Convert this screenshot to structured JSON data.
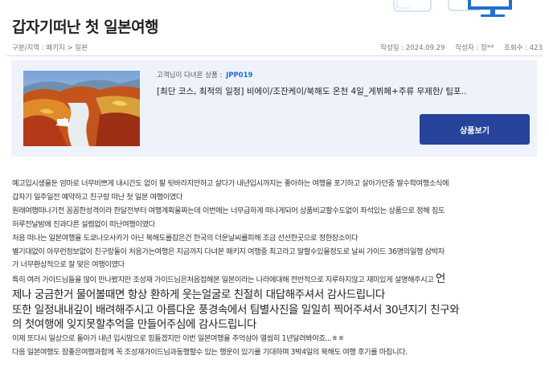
{
  "page": {
    "title": "갑자기떠난 첫 일본여행",
    "breadcrumb": "구분/지역 : 패키지 > 일본",
    "date": "작성일 : 2024.09.29",
    "author": "작성자 : 정**",
    "views": "조회수 : 423"
  },
  "product": {
    "code_label": "고객님이 다녀온 상품 :",
    "code": "JPP019",
    "name": "[최단 코스, 최적의 일정] 비에이/조잔케이/북해도 온천 4일_게뷔페+주류 무제한/ 팁포..",
    "button_label": "상품보기",
    "thumbnail_icon": "autumn-gorge-photo"
  },
  "review": {
    "lines": [
      "예고입시생을둔 엄마로 너무비쁘게 내시간도 없이 팔 뒷바라지만하고 살다가 내년입시까지는 좋아하는 여행을 포기하고 살아가던중 딸수학여행소식에",
      "갑자기 일주일전 예약하고 친구랑 떠난 첫 일본 여행이였다",
      "원래여행떠나기전 꼼꼼한성격이라 한달전부터 여행계획을짜는데 이번에는 너무급하게 떠나게되어 상품비교할수도없이 좌석있는 상품으로 정해 짐도",
      "허루전날밤에 진과다른 설렘없이 떠난여행이였다",
      "처음 떠나는 일본여행을 도쿄나오사카가 아닌 북해도를잡은건 한국의 더운날씨를피해 조금 선선한곳으로 정한장소이다",
      "별기대없이 아무런정보없이 친구랑둘이 처음가는여행은 지금까지 다녀본 패키지 여행중 최고라고 말할수있을정도로 날씨 가이드 36명의일행 삼박자",
      "가 너무환상적으로 잘 맞은 여행이였다"
    ],
    "mixed_small": "특히 여러 가이드님들을 많이 만나봤지만 조성재 가이드님은처음접해본 일본이라는 나라에대해 전반적으로 지루하지않고 재미있게 설명해주시고",
    "mixed_big": "언",
    "big_lines": [
      "제나 궁금한거 물어볼때면 항상 환하게 웃는얼굴로 친절히 대답해주셔서 감사드립니다",
      "또한 일정내내깊이 배려해주시고 아름다운 풍경속에서 팀별사진을 일일히 찍어주셔서 30년지기 친구와",
      "의 첫여행에 잊지못할추억을 만들어주심에 감사드립니다"
    ],
    "after_lines": [
      "이제 또다시 일상으로 돌아가  내년 입시맘으로 힘들겠지만 이번 일본여행을 추억삼아 열씸히 1년달려봐야죠...ㅎㅎ",
      "다음 일본여행도 참좋은여행과함께 꼭 조성재가이드님과동행할수 있는 행운이 있기를 기대하며 3박4일의 북해도 여행 후기를 마칩니다."
    ]
  },
  "colors": {
    "accent_blue": "#1d6dd8",
    "button_navy": "#26449c",
    "box_bg": "#eef3fb"
  }
}
